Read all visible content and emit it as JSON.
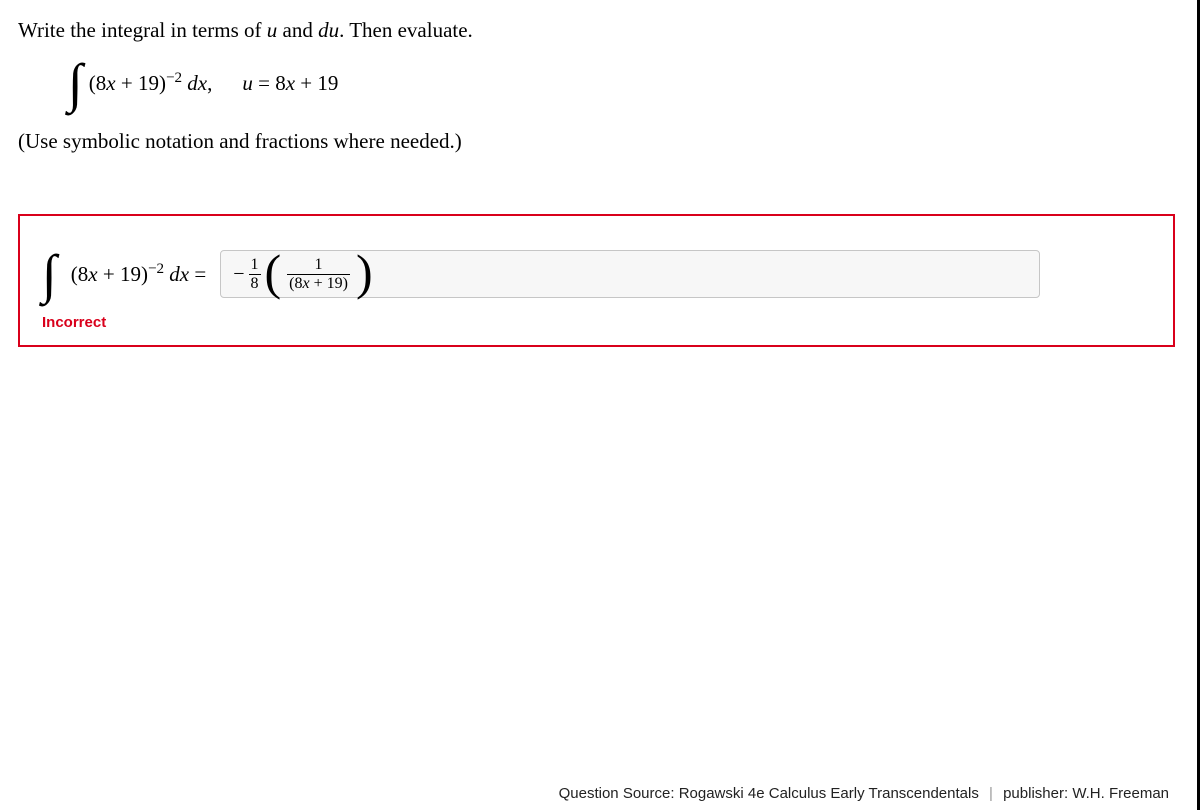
{
  "prompt": {
    "pre": "Write the integral in terms of ",
    "u": "u",
    "and": " and ",
    "du": "du",
    "post": ". Then evaluate."
  },
  "integral": {
    "base": "(8",
    "x": "x",
    "after_x": " + 19)",
    "exp": "−2",
    "dx_space": " ",
    "d": "d",
    "dx_x": "x",
    "comma": ",",
    "sub_u": "u",
    "eq": " = 8",
    "sub_x": "x",
    "tail": " + 19"
  },
  "note": "(Use symbolic notation and fractions where needed.)",
  "answer": {
    "lhs_base": "(8",
    "lhs_x": "x",
    "lhs_after": " + 19)",
    "lhs_exp": "−2",
    "lhs_d": "d",
    "lhs_dx_x": "x",
    "lhs_eq": " =",
    "minus": "−",
    "coef_num": "1",
    "coef_den": "8",
    "inner_num": "1",
    "inner_den_pre": "(8",
    "inner_den_x": "x",
    "inner_den_post": " + 19)"
  },
  "feedback": "Incorrect",
  "footer": {
    "source_label": "Question Source: ",
    "source": "Rogawski 4e Calculus Early Transcendentals",
    "separator": "|",
    "publisher_label": "publisher: ",
    "publisher": "W.H. Freeman"
  }
}
